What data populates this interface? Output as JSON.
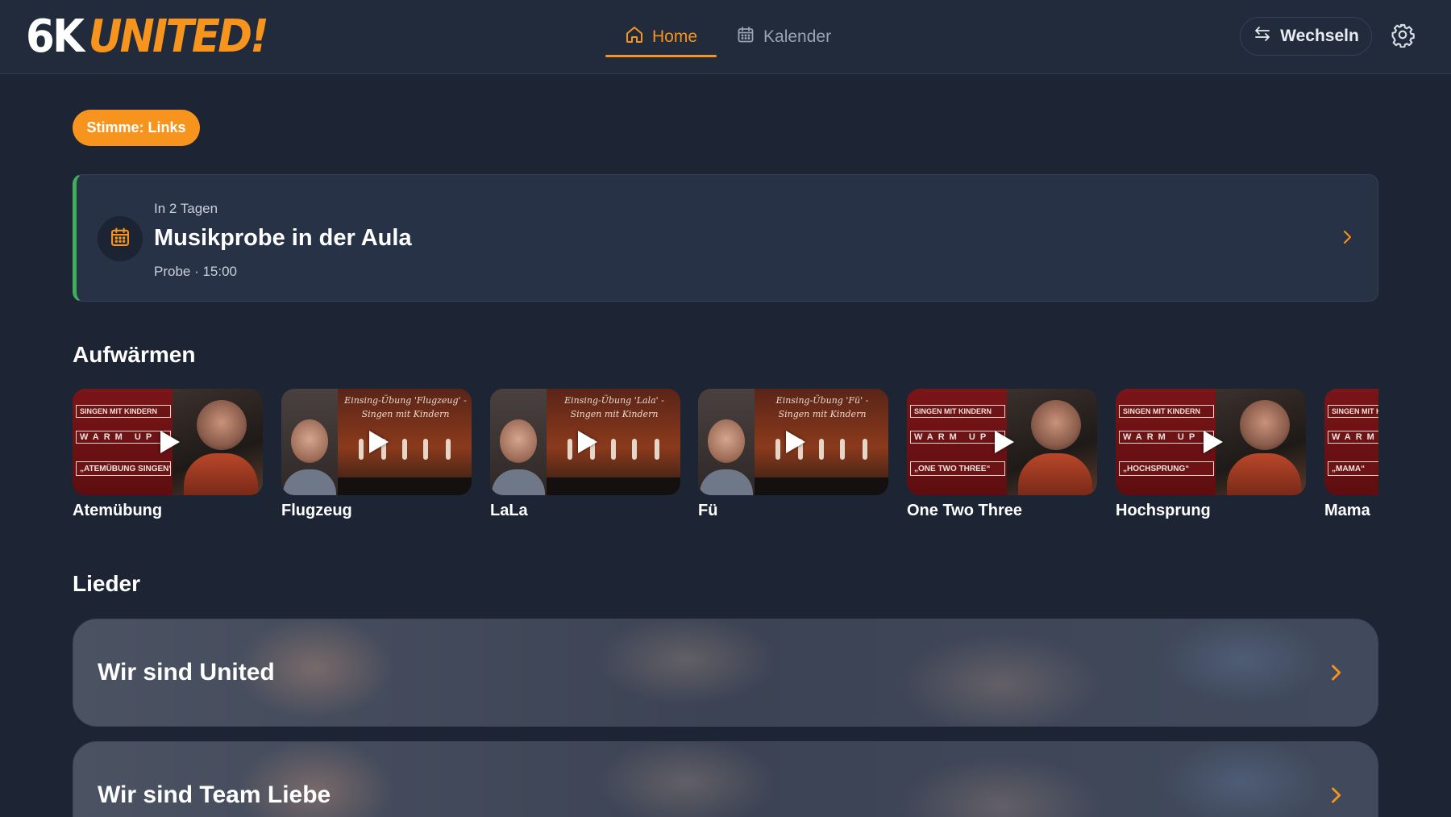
{
  "header": {
    "logo_part1": "6K",
    "logo_part2": "UNITED!",
    "nav": [
      {
        "label": "Home",
        "icon": "home-icon",
        "active": true
      },
      {
        "label": "Kalender",
        "icon": "calendar-icon",
        "active": false
      }
    ],
    "switch_label": "Wechseln",
    "switch_icon": "swap-arrows-icon",
    "settings_icon": "gear-icon"
  },
  "voice_chip": "Stimme: Links",
  "next_event": {
    "when": "In 2 Tagen",
    "title": "Musikprobe in der Aula",
    "meta": "Probe · 15:00",
    "icon": "calendar-icon",
    "accent_color": "#3fae5a"
  },
  "warmup": {
    "title": "Aufwärmen",
    "items": [
      {
        "label": "Atemübung",
        "style": "banner",
        "banner1": "SINGEN MIT KINDERN",
        "banner2": "WARM UP",
        "banner3": "„ATEMÜBUNG SINGEN“"
      },
      {
        "label": "Flugzeug",
        "style": "stage",
        "caption": "Einsing-Übung 'Flugzeug' - Singen mit Kindern"
      },
      {
        "label": "LaLa",
        "style": "stage",
        "caption": "Einsing-Übung 'Lala' - Singen mit Kindern"
      },
      {
        "label": "Fü",
        "style": "stage",
        "caption": "Einsing-Übung 'Fü' - Singen mit Kindern"
      },
      {
        "label": "One Two Three",
        "style": "banner",
        "banner1": "SINGEN MIT KINDERN",
        "banner2": "WARM UP",
        "banner3": "„ONE TWO THREE“"
      },
      {
        "label": "Hochsprung",
        "style": "banner",
        "banner1": "SINGEN MIT KINDERN",
        "banner2": "WARM UP",
        "banner3": "„HOCHSPRUNG“"
      },
      {
        "label": "Mama",
        "style": "banner",
        "banner1": "SINGEN MIT KINDERN",
        "banner2": "WARM UP",
        "banner3": "„MAMA“"
      }
    ]
  },
  "songs": {
    "title": "Lieder",
    "items": [
      {
        "label": "Wir sind United"
      },
      {
        "label": "Wir sind Team Liebe"
      }
    ]
  },
  "colors": {
    "accent": "#f7941d",
    "background": "#1d2535",
    "header": "#222b3c",
    "card": "#283246"
  }
}
